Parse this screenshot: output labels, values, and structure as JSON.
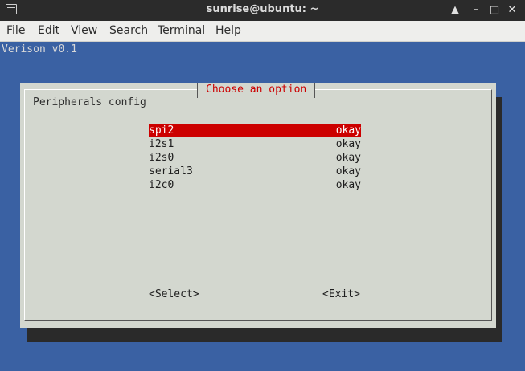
{
  "window": {
    "title": "sunrise@ubuntu: ~",
    "buttons": {
      "up": "▲",
      "minimize": "–",
      "maximize": "□",
      "close": "✕"
    }
  },
  "menu": [
    "File",
    "Edit",
    "View",
    "Search",
    "Terminal",
    "Help"
  ],
  "terminal": {
    "version_line": "Verison v0.1"
  },
  "dialog": {
    "title": "Choose an option",
    "subtitle": "Peripherals config",
    "items": [
      {
        "name": "spi2",
        "status": "okay",
        "selected": true
      },
      {
        "name": "i2s1",
        "status": "okay",
        "selected": false
      },
      {
        "name": "i2s0",
        "status": "okay",
        "selected": false
      },
      {
        "name": "serial3",
        "status": "okay",
        "selected": false
      },
      {
        "name": "i2c0",
        "status": "okay",
        "selected": false
      }
    ],
    "select_label": "<Select>",
    "exit_label": "<Exit>"
  },
  "colors": {
    "terminal_bg": "#3a61a3",
    "dialog_bg": "#d3d7cf",
    "accent": "#cc0000"
  }
}
